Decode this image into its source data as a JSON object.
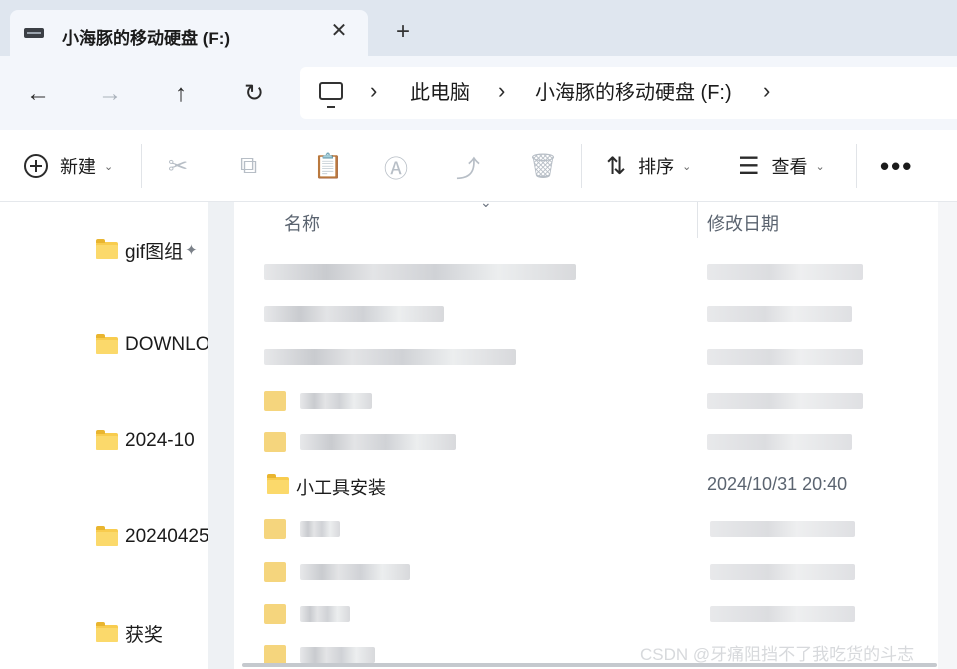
{
  "tab": {
    "title": "小海豚的移动硬盘 (F:)",
    "close_glyph": "✕",
    "new_tab_glyph": "+"
  },
  "nav": {
    "back": "←",
    "forward": "→",
    "up": "↑",
    "refresh": "↻"
  },
  "address": {
    "separators": [
      "›",
      "›",
      "›"
    ],
    "crumbs": [
      "此电脑",
      "小海豚的移动硬盘 (F:)"
    ]
  },
  "commands": {
    "new_label": "新建",
    "sort_label": "排序",
    "view_label": "查看",
    "more_glyph": "•••",
    "chevron": "⌄",
    "icons": [
      "cut-icon",
      "copy-icon",
      "paste-icon",
      "rename-icon",
      "share-icon",
      "delete-icon",
      "sort-icon",
      "view-icon"
    ]
  },
  "sidebar": {
    "items": [
      {
        "label": "gif图组",
        "pinned": true
      },
      {
        "label": "DOWNLO"
      },
      {
        "label": "2024-10"
      },
      {
        "label": "20240425"
      },
      {
        "label": "获奖"
      }
    ],
    "pin_glyph": "📌"
  },
  "filelist": {
    "columns": {
      "name": "名称",
      "date": "修改日期"
    },
    "sort_caret": "⌄",
    "visible_row": {
      "name": "小工具安装",
      "date": "2024/10/31 20:40"
    }
  },
  "watermark": "CSDN @牙痛阻挡不了我吃货的斗志",
  "colors": {
    "folder": "#f8cc4e",
    "titlebar": "#dfe6ef",
    "navbar": "#f3f6fb"
  }
}
